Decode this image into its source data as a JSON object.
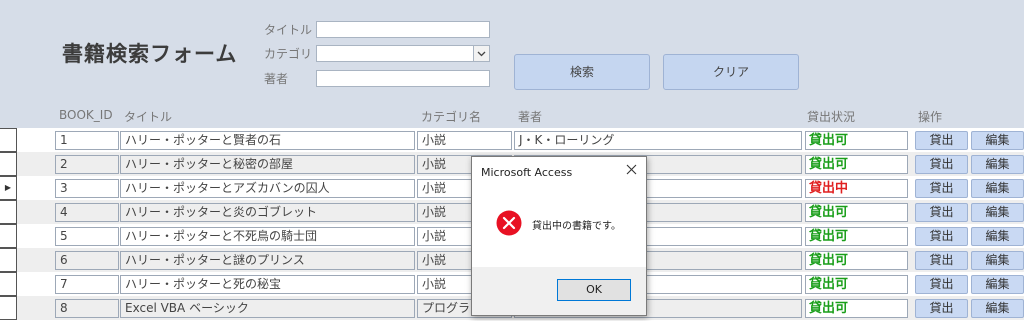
{
  "form": {
    "title": "書籍検索フォーム",
    "search": {
      "title_label": "タイトル",
      "category_label": "カテゴリ",
      "author_label": "著者",
      "title_value": "",
      "category_value": "",
      "author_value": ""
    },
    "buttons": {
      "search": "検索",
      "clear": "クリア"
    }
  },
  "columns": {
    "book_id": "BOOK_ID",
    "title": "タイトル",
    "category": "カテゴリ名",
    "author": "著者",
    "status": "貸出状況",
    "action": "操作"
  },
  "rows": [
    {
      "id": "1",
      "title": "ハリー・ポッターと賢者の石",
      "category": "小説",
      "author": "J・K・ローリング",
      "status": "貸出可",
      "status_color": "#1a9e1a",
      "lend": "貸出",
      "edit": "編集"
    },
    {
      "id": "2",
      "title": "ハリー・ポッターと秘密の部屋",
      "category": "小説",
      "author": "",
      "status": "貸出可",
      "status_color": "#1a9e1a",
      "lend": "貸出",
      "edit": "編集"
    },
    {
      "id": "3",
      "title": "ハリー・ポッターとアズカバンの囚人",
      "category": "小説",
      "author": "",
      "status": "貸出中",
      "status_color": "#e02020",
      "lend": "貸出",
      "edit": "編集"
    },
    {
      "id": "4",
      "title": "ハリー・ポッターと炎のゴブレット",
      "category": "小説",
      "author": "",
      "status": "貸出可",
      "status_color": "#1a9e1a",
      "lend": "貸出",
      "edit": "編集"
    },
    {
      "id": "5",
      "title": "ハリー・ポッターと不死鳥の騎士団",
      "category": "小説",
      "author": "",
      "status": "貸出可",
      "status_color": "#1a9e1a",
      "lend": "貸出",
      "edit": "編集"
    },
    {
      "id": "6",
      "title": "ハリー・ポッターと謎のプリンス",
      "category": "小説",
      "author": "",
      "status": "貸出可",
      "status_color": "#1a9e1a",
      "lend": "貸出",
      "edit": "編集"
    },
    {
      "id": "7",
      "title": "ハリー・ポッターと死の秘宝",
      "category": "小説",
      "author": "",
      "status": "貸出可",
      "status_color": "#1a9e1a",
      "lend": "貸出",
      "edit": "編集"
    },
    {
      "id": "8",
      "title": "Excel VBA ベーシック",
      "category": "プログラミング",
      "author": "",
      "status": "貸出可",
      "status_color": "#1a9e1a",
      "lend": "貸出",
      "edit": "編集"
    }
  ],
  "dialog": {
    "title": "Microsoft Access",
    "message": "貸出中の書籍です。",
    "ok": "OK",
    "icon": "error-icon",
    "close_icon": "close-icon"
  },
  "record_selector": {
    "current_icon": "triangle-right-icon"
  }
}
